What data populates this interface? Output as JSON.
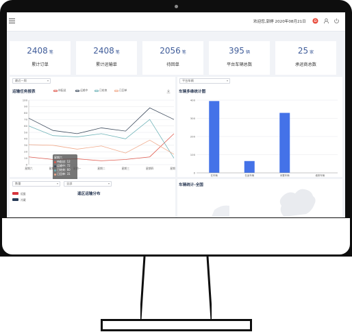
{
  "header": {
    "welcome": "欢迎您,郭婷 2020年08月21日"
  },
  "stats": [
    {
      "value": "2408",
      "unit": "笔",
      "label": "累计订单"
    },
    {
      "value": "2408",
      "unit": "笔",
      "label": "累计运输单"
    },
    {
      "value": "2056",
      "unit": "笔",
      "label": "待回单"
    },
    {
      "value": "395",
      "unit": "辆",
      "label": "平台车辆总数"
    },
    {
      "value": "25",
      "unit": "家",
      "label": "承运商总数"
    }
  ],
  "task_panel": {
    "period_select": "最近一周",
    "title": "运输任务报表",
    "legend": [
      "待配送",
      "运输中",
      "已结束",
      "已回单"
    ],
    "tooltip": {
      "day": "星期六",
      "rows": [
        "待配送: 12",
        "运输中: 72",
        "已结束: 60",
        "已回单: 31"
      ]
    }
  },
  "vehicle_panel": {
    "select": "平台车辆",
    "title": "车辆多维统计图"
  },
  "region_panel": {
    "select_a": "数量",
    "select_b": "全部",
    "title": "逞区运输分布",
    "legend": [
      "组蛋",
      "冷藏"
    ]
  },
  "fleet_panel": {
    "title": "车辆统计-全国"
  },
  "colors": {
    "accent": "#3f5c99",
    "bar": "#4472e8",
    "s_pending": "#e05a4f",
    "s_transit": "#3c4a5c",
    "s_done": "#6fb3b8",
    "s_returned": "#f0a98a"
  },
  "chart_data": [
    {
      "type": "line",
      "title": "运输任务报表",
      "x": [
        "星期六",
        "星期日",
        "星期一",
        "星期二",
        "星期三",
        "星期四",
        "星期五"
      ],
      "ylim": [
        0,
        100
      ],
      "yticks": [
        0,
        10,
        20,
        30,
        40,
        50,
        60,
        70,
        80,
        90,
        100
      ],
      "series": [
        {
          "name": "待配送",
          "values": [
            12,
            8,
            9,
            6,
            8,
            12,
            48
          ]
        },
        {
          "name": "运输中",
          "values": [
            72,
            53,
            48,
            57,
            52,
            88,
            70
          ]
        },
        {
          "name": "已结束",
          "values": [
            60,
            45,
            43,
            48,
            40,
            70,
            10
          ]
        },
        {
          "name": "已回单",
          "values": [
            31,
            30,
            24,
            29,
            18,
            38,
            16
          ]
        }
      ],
      "legend_position": "top"
    },
    {
      "type": "bar",
      "title": "车辆多维统计图",
      "categories": [
        "在车辆",
        "在途车辆",
        "闲置车辆",
        "维修车辆"
      ],
      "values": [
        395,
        65,
        330,
        0
      ],
      "ylim": [
        0,
        400
      ],
      "yticks": [
        0,
        100,
        200,
        300,
        400
      ]
    }
  ]
}
